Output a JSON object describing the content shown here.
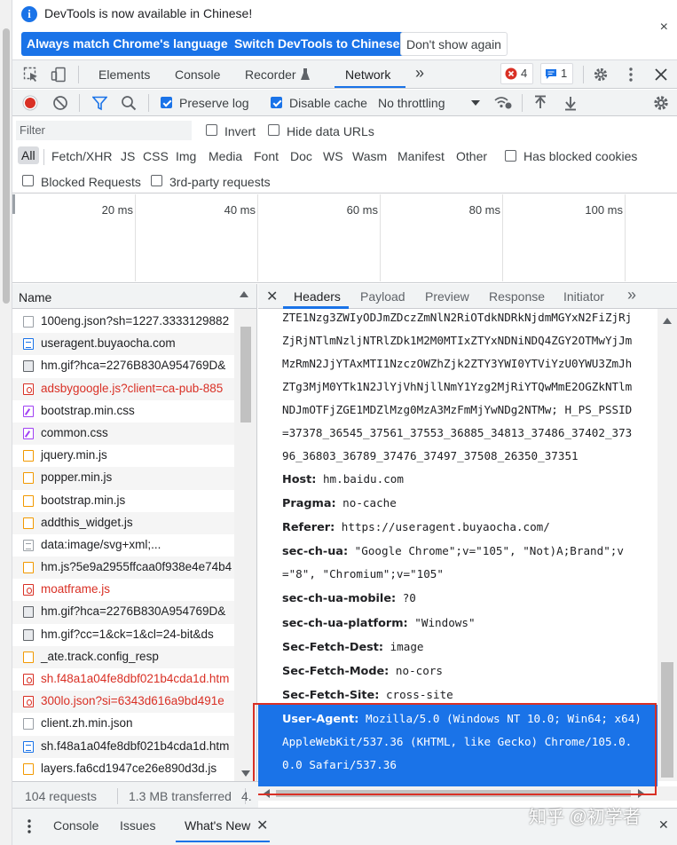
{
  "infobar": {
    "message": "DevTools is now available in Chinese!",
    "buttons": [
      "Always match Chrome's language",
      "Switch DevTools to Chinese",
      "Don't show again"
    ],
    "close": "×"
  },
  "main_tabs": [
    "Elements",
    "Console",
    "Recorder",
    "Network"
  ],
  "active_tab": "Network",
  "more_tabs": "»",
  "errors_count": "4",
  "messages_count": "1",
  "toolbar": {
    "preserve_log": "Preserve log",
    "disable_cache": "Disable cache",
    "throttling": "No throttling"
  },
  "filter": {
    "placeholder": "Filter",
    "invert": "Invert",
    "hide_data_urls": "Hide data URLs"
  },
  "types": [
    "All",
    "Fetch/XHR",
    "JS",
    "CSS",
    "Img",
    "Media",
    "Font",
    "Doc",
    "WS",
    "Wasm",
    "Manifest",
    "Other"
  ],
  "has_blocked_cookies": "Has blocked cookies",
  "blocked_requests": "Blocked Requests",
  "third_party": "3rd-party requests",
  "timeline_ticks": [
    "20 ms",
    "40 ms",
    "60 ms",
    "80 ms",
    "100 ms"
  ],
  "list": {
    "header": "Name",
    "rows": [
      {
        "name": "100eng.json?sh=1227.3333129882",
        "icon": "blank",
        "red": false
      },
      {
        "name": "useragent.buyaocha.com",
        "icon": "doc",
        "red": false
      },
      {
        "name": "hm.gif?hca=2276B830A954769D&",
        "icon": "img",
        "red": false
      },
      {
        "name": "adsbygoogle.js?client=ca-pub-885",
        "icon": "err",
        "red": true
      },
      {
        "name": "bootstrap.min.css",
        "icon": "css",
        "red": false
      },
      {
        "name": "common.css",
        "icon": "css",
        "red": false
      },
      {
        "name": "jquery.min.js",
        "icon": "script",
        "red": false
      },
      {
        "name": "popper.min.js",
        "icon": "script",
        "red": false
      },
      {
        "name": "bootstrap.min.js",
        "icon": "script",
        "red": false
      },
      {
        "name": "addthis_widget.js",
        "icon": "script",
        "red": false
      },
      {
        "name": "data:image/svg+xml;...",
        "icon": "data",
        "red": false
      },
      {
        "name": "hm.js?5e9a2955ffcaa0f938e4e74b4",
        "icon": "script",
        "red": false
      },
      {
        "name": "moatframe.js",
        "icon": "err",
        "red": true
      },
      {
        "name": "hm.gif?hca=2276B830A954769D&",
        "icon": "img",
        "red": false
      },
      {
        "name": "hm.gif?cc=1&ck=1&cl=24-bit&ds",
        "icon": "img",
        "red": false
      },
      {
        "name": "_ate.track.config_resp",
        "icon": "script",
        "red": false
      },
      {
        "name": "sh.f48a1a04fe8dbf021b4cda1d.htm",
        "icon": "err",
        "red": true
      },
      {
        "name": "300lo.json?si=6343d616a9bd491e",
        "icon": "err",
        "red": true
      },
      {
        "name": "client.zh.min.json",
        "icon": "blank",
        "red": false
      },
      {
        "name": "sh.f48a1a04fe8dbf021b4cda1d.htm",
        "icon": "doc",
        "red": false
      },
      {
        "name": "layers.fa6cd1947ce26e890d3d.js",
        "icon": "script",
        "red": false
      }
    ]
  },
  "detail_tabs": [
    "Headers",
    "Payload",
    "Preview",
    "Response",
    "Initiator"
  ],
  "headers": {
    "cookie_lines": [
      "ZTE1Nzg3ZWIyODJmZDczZmNlN2RiOTdkNDRkNjdmMGYxN2FiZjRj",
      "ZjRjNTlmNzljNTRlZDk1M2M0MTIxZTYxNDNiNDQ4ZGY2OTMwYjJm",
      "MzRmN2JjYTAxMTI1NzczOWZhZjk2ZTY3YWI0YTViYzU0YWU3ZmJh",
      "ZTg3MjM0YTk1N2JlYjVhNjllNmY1Yzg2MjRiYTQwMmE2OGZkNTlm",
      "NDJmOTFjZGE1MDZlMzg0MzA3MzFmMjYwNDg2NTMw; H_PS_PSSID",
      "=37378_36545_37561_37553_36885_34813_37486_37402_373",
      "96_36803_36789_37476_37497_37508_26350_37351"
    ],
    "host_name": "Host:",
    "host_value": "hm.baidu.com",
    "pragma_name": "Pragma:",
    "pragma_value": "no-cache",
    "referer_name": "Referer:",
    "referer_value": "https://useragent.buyaocha.com/",
    "ua_name": "sec-ch-ua:",
    "ua_value_1": "\"Google Chrome\";v=\"105\", \"Not)A;Brand\";v",
    "ua_value_2": "=\"8\", \"Chromium\";v=\"105\"",
    "mobile_name": "sec-ch-ua-mobile:",
    "mobile_value": "?0",
    "platform_name": "sec-ch-ua-platform:",
    "platform_value": "\"Windows\"",
    "dest_name": "Sec-Fetch-Dest:",
    "dest_value": "image",
    "mode_name": "Sec-Fetch-Mode:",
    "mode_value": "no-cors",
    "site_name": "Sec-Fetch-Site:",
    "site_value": "cross-site",
    "useragent_name": "User-Agent:",
    "useragent_value_1": "Mozilla/5.0 (Windows NT 10.0; Win64; x64)",
    "useragent_value_2": "AppleWebKit/537.36 (KHTML, like Gecko) Chrome/105.0.",
    "useragent_value_3": "0.0 Safari/537.36"
  },
  "status": {
    "requests": "104 requests",
    "transferred": "1.3 MB transferred",
    "more": "4."
  },
  "drawer_tabs": [
    "Console",
    "Issues",
    "What's New"
  ],
  "watermark": "知乎 @初学者",
  "colors": {
    "accent": "#1a73e8",
    "error": "#d93025",
    "highlight_box": "#d93025"
  }
}
